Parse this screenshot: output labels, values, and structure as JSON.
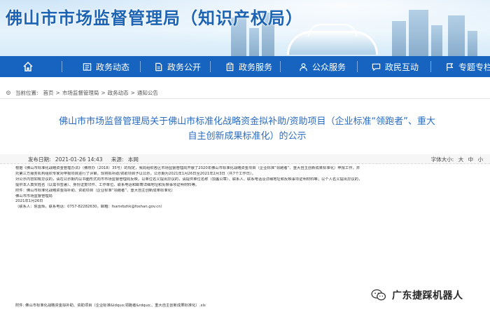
{
  "site": {
    "title": "佛山市市场监督管理局（知识产权局）"
  },
  "nav": {
    "items": [
      {
        "label": "",
        "icon": "home-icon"
      },
      {
        "label": "政务动态",
        "icon": "newspaper-icon"
      },
      {
        "label": "政务公开",
        "icon": "document-icon"
      },
      {
        "label": "政务服务",
        "icon": "clipboard-icon"
      },
      {
        "label": "公众服务",
        "icon": "people-icon"
      },
      {
        "label": "政民互动",
        "icon": "chat-icon"
      },
      {
        "label": "专题专栏",
        "icon": "flag-icon"
      }
    ]
  },
  "breadcrumb": {
    "prefix": "当前位置:",
    "items": [
      "首页",
      "市场监督管理局",
      "政务动态",
      "通知公告"
    ],
    "separator": ">"
  },
  "article": {
    "title_line1": "佛山市市场监督管理局关于佛山市标准化战略资金拟补助/资助项目（企业标准“领跑者”、重大",
    "title_line2": "自主创新成果标准化）的公示",
    "publish_label": "发布日期:",
    "publish_date": "2021-01-26 14:43",
    "source_label": "来源:",
    "source": "本网",
    "fontsize_label": "字体大小:",
    "fontsize_large": "大",
    "fontsize_medium": "中",
    "fontsize_small": "小",
    "body_lines": [
      "根据《佛山市标准化战略资金管理办法》（佛府办〔2018〕35号）的规定，我局组织各区市场监督管理局开展了2020年佛山市标准化战略资金项目（企业标准“领跑者”、重大自主创新成果标准化）申报工作，并",
      "托第三方服务机构组织专家对申报项目进行了评审。现将拟补助/资助项目予以公示，公示期为2021年1月26日至2021年2月3日（共7个工作日）。",
      "对公示内容如有异议的，请在公示期内以书面形式向市市场监督管理局反映，以单位名义提出异议的，请提供单位名称（加盖公章）、联系人、联系电话及详细地址和反映事项证明材料等；以个人名义提出异议的，",
      "提供本人真实姓名（以需书签署）、身份证复印件、工作单位、联系电话和邮寄详细地址和反映事项证明材料等。",
      "附件：佛山市标准化战略资金拟补助、资助项目（企业标准“领跑者”、重大自主创新成果标准化）",
      "佛山市市场监督管理局",
      "2021年1月26日",
      "（联系人：陈壹辉，联系电话：0757-82282630，邮箱：fsamrbzhk@foshan.gov.cn）"
    ],
    "attachment": "附件: 佛山市标准化战略资金拟补助、资助项目（企业标准&ldquo;领跑者&rdquo;、重大自主创新成果标准化）.xls"
  },
  "watermark": {
    "text": "广东捷踩机器人",
    "icon": "wechat-icon"
  },
  "colors": {
    "nav_bg": "#1664c0",
    "title_blue": "#2b6cc0",
    "site_title": "#1d63b3"
  }
}
